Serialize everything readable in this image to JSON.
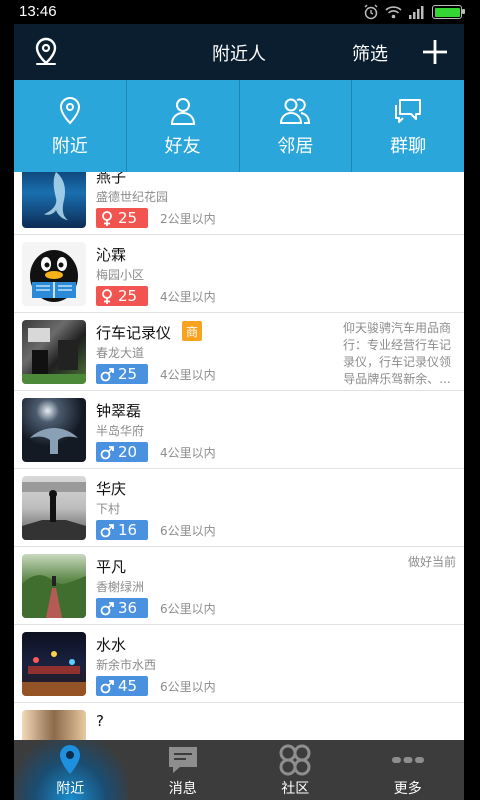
{
  "status_bar": {
    "time": "13:46"
  },
  "header": {
    "title": "附近人",
    "filter_label": "筛选"
  },
  "tabs": [
    {
      "label": "附近",
      "icon": "location-pin-icon"
    },
    {
      "label": "好友",
      "icon": "person-icon"
    },
    {
      "label": "邻居",
      "icon": "two-people-icon"
    },
    {
      "label": "群聊",
      "icon": "chat-bubbles-icon"
    }
  ],
  "people": [
    {
      "name": "燕子",
      "place": "盛德世纪花园",
      "gender": "female",
      "age": "25",
      "distance": "2公里以内",
      "signature": ""
    },
    {
      "name": "沁霖",
      "place": "梅园小区",
      "gender": "female",
      "age": "25",
      "distance": "4公里以内",
      "signature": ""
    },
    {
      "name": "行车记录仪",
      "badge": "商",
      "place": "春龙大道",
      "gender": "male",
      "age": "25",
      "distance": "4公里以内",
      "signature": "仰天骏骋汽车用品商行：专业经营行车记录仪，行车记录仪领导品牌乐驾新余、..."
    },
    {
      "name": "钟翠磊",
      "place": "半岛华府",
      "gender": "male",
      "age": "20",
      "distance": "4公里以内",
      "signature": ""
    },
    {
      "name": "华庆",
      "place": "下村",
      "gender": "male",
      "age": "16",
      "distance": "6公里以内",
      "signature": ""
    },
    {
      "name": "平凡",
      "place": "香榭绿洲",
      "gender": "male",
      "age": "36",
      "distance": "6公里以内",
      "signature": "做好当前"
    },
    {
      "name": "水水",
      "place": "新余市水西",
      "gender": "male",
      "age": "45",
      "distance": "6公里以内",
      "signature": ""
    },
    {
      "name": "?",
      "place": "",
      "gender": "male",
      "age": "",
      "distance": "",
      "signature": ""
    }
  ],
  "bottom_nav": [
    {
      "label": "附近",
      "icon": "location-pin-icon",
      "active": true
    },
    {
      "label": "消息",
      "icon": "message-icon",
      "active": false
    },
    {
      "label": "社区",
      "icon": "community-icon",
      "active": false
    },
    {
      "label": "更多",
      "icon": "more-icon",
      "active": false
    }
  ],
  "colors": {
    "header_bg": "#0a1e30",
    "tab_bg": "#2aa6da",
    "female": "#f2554f",
    "male": "#4a92e0",
    "biz": "#f7a31f",
    "nav_bg": "#3c3c3c"
  }
}
